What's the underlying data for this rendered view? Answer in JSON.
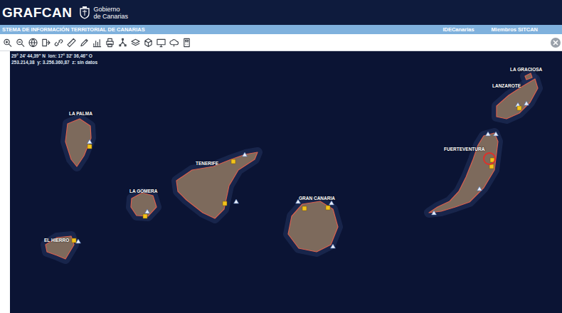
{
  "header": {
    "logo": "GRAFCAN",
    "government": [
      "Gobierno",
      "de Canarias"
    ]
  },
  "menu_bar": {
    "title": "STEMA DE INFORMACIÓN TERRITORIAL DE CANARIAS",
    "links": [
      "IDECanarias",
      "Miembros SITCAN"
    ]
  },
  "coordinates": [
    "29° 24' 44,39\" N  lon: 17° 32' 36,46\" O",
    "253.214,38  y: 3.256.360,87  z: sin datos"
  ],
  "islands": [
    {
      "label": "LA PALMA"
    },
    {
      "label": "EL HIERRO"
    },
    {
      "label": "LA GOMERA"
    },
    {
      "label": "TENERIFE"
    },
    {
      "label": "GRAN CANARIA"
    },
    {
      "label": "FUERTEVENTURA"
    },
    {
      "label": "LANZAROTE"
    },
    {
      "label": "LA GRACIOSA"
    }
  ]
}
